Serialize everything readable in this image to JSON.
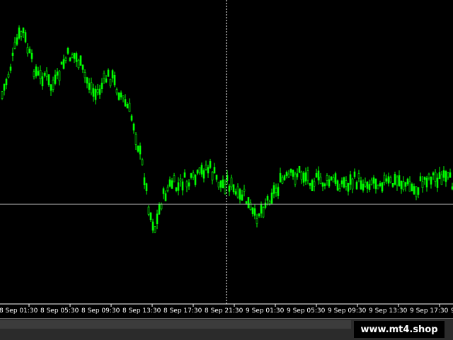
{
  "colors": {
    "background": "#000000",
    "candle": "#00ff00",
    "crosshair": "#c0c0c0",
    "axis_text": "#ffffff",
    "bottom_bar": "#2b2b2b"
  },
  "chart_data": {
    "type": "candlestick",
    "x_tick_labels": [
      "8 Sep 01:30",
      "8 Sep 05:30",
      "8 Sep 09:30",
      "8 Sep 13:30",
      "8 Sep 17:30",
      "8 Sep 21:30",
      "9 Sep 01:30",
      "9 Sep 05:30",
      "9 Sep 09:30",
      "9 Sep 13:30",
      "9 Sep 17:30",
      "9 Se"
    ],
    "series_shape": [
      0.32,
      0.25,
      0.18,
      0.1,
      0.06,
      0.14,
      0.2,
      0.24,
      0.22,
      0.27,
      0.26,
      0.2,
      0.16,
      0.15,
      0.17,
      0.22,
      0.26,
      0.3,
      0.28,
      0.24,
      0.23,
      0.27,
      0.31,
      0.35,
      0.4,
      0.5,
      0.6,
      0.74,
      0.8,
      0.7,
      0.66,
      0.63,
      0.65,
      0.62,
      0.63,
      0.62,
      0.6,
      0.57,
      0.58,
      0.61,
      0.64,
      0.62,
      0.65,
      0.69,
      0.67,
      0.72,
      0.76,
      0.73,
      0.7,
      0.67,
      0.65,
      0.62,
      0.61,
      0.6,
      0.59,
      0.6,
      0.61,
      0.62,
      0.62,
      0.63,
      0.62,
      0.63,
      0.63,
      0.63,
      0.62,
      0.62,
      0.63,
      0.62,
      0.62,
      0.62,
      0.63,
      0.63,
      0.62,
      0.63,
      0.64,
      0.66,
      0.63,
      0.61,
      0.6,
      0.61,
      0.62,
      0.62,
      0.63
    ],
    "crosshair": {
      "x_fraction": 0.5,
      "y_fraction": 0.68
    },
    "grid": false,
    "legend": "none"
  },
  "watermark": {
    "text": "www.mt4.shop"
  }
}
